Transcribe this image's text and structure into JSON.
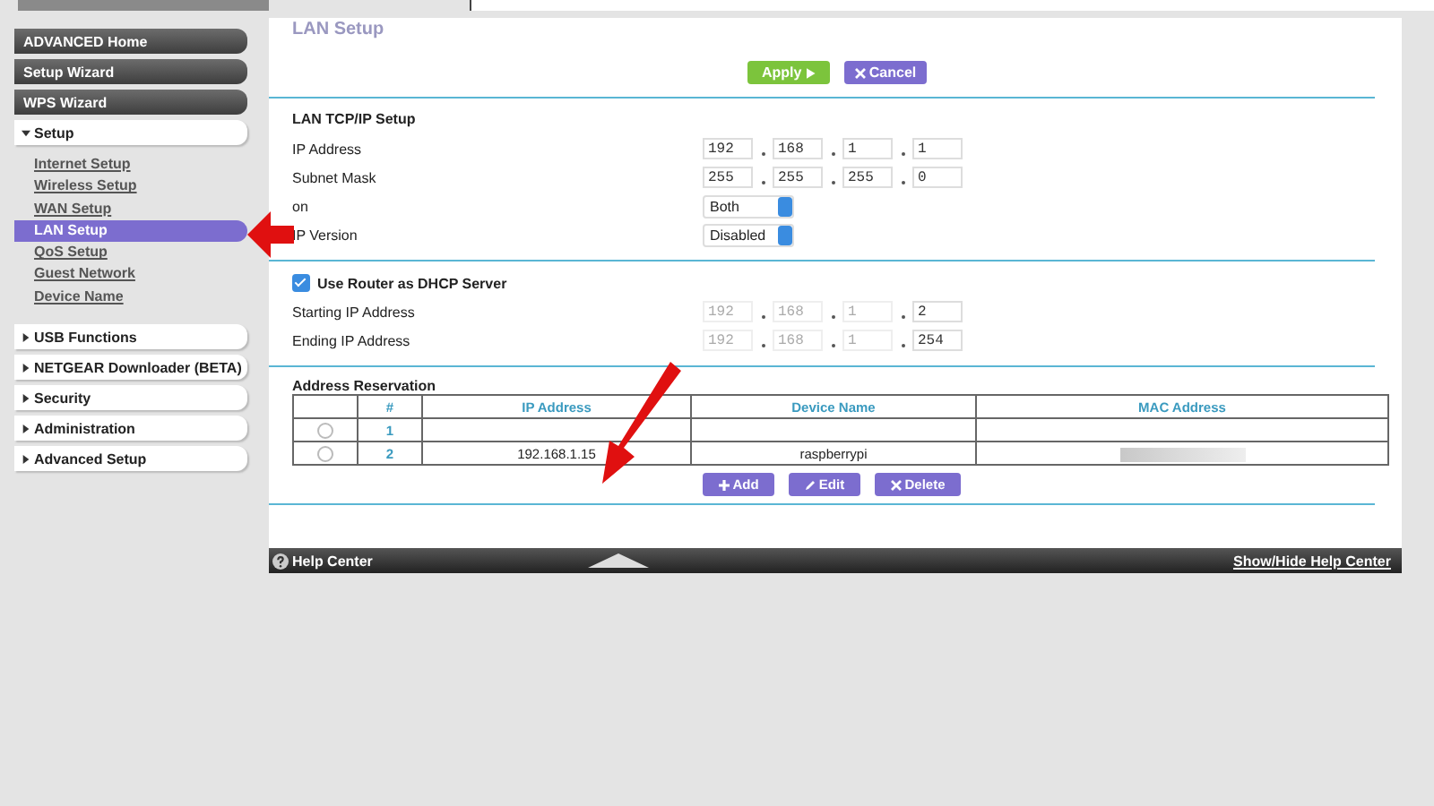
{
  "sidebar": {
    "buttons": [
      {
        "label": "ADVANCED Home"
      },
      {
        "label": "Setup Wizard"
      },
      {
        "label": "WPS Wizard"
      }
    ],
    "sections": [
      {
        "label": "Setup",
        "expanded": true,
        "children": [
          {
            "label": "Internet Setup",
            "selected": false
          },
          {
            "label": "Wireless Setup",
            "selected": false
          },
          {
            "label": "WAN Setup",
            "selected": false
          },
          {
            "label": "LAN Setup",
            "selected": true
          },
          {
            "label": "QoS Setup",
            "selected": false
          },
          {
            "label": "Guest Network",
            "selected": false
          },
          {
            "label": "Device Name",
            "selected": false
          }
        ]
      },
      {
        "label": "USB Functions",
        "expanded": false
      },
      {
        "label": "NETGEAR Downloader (BETA)",
        "expanded": false
      },
      {
        "label": "Security",
        "expanded": false
      },
      {
        "label": "Administration",
        "expanded": false
      },
      {
        "label": "Advanced Setup",
        "expanded": false
      }
    ]
  },
  "page": {
    "title": "LAN Setup",
    "actions": [
      {
        "label": "Apply",
        "kind": "apply"
      },
      {
        "label": "Cancel",
        "kind": "cancel"
      }
    ]
  },
  "tcpip": {
    "heading": "LAN TCP/IP Setup",
    "rows": [
      {
        "label": "IP Address",
        "kind": "ip",
        "octets": [
          {
            "value": "192",
            "disabled": false
          },
          {
            "value": "168",
            "disabled": false
          },
          {
            "value": "1",
            "disabled": false
          },
          {
            "value": "1",
            "disabled": false
          }
        ]
      },
      {
        "label": "Subnet Mask",
        "kind": "ip",
        "octets": [
          {
            "value": "255",
            "disabled": false
          },
          {
            "value": "255",
            "disabled": false
          },
          {
            "value": "255",
            "disabled": false
          },
          {
            "value": "0",
            "disabled": false
          }
        ]
      },
      {
        "label": "on",
        "kind": "select",
        "value": "Both"
      },
      {
        "label": "IP Version",
        "kind": "select",
        "value": "Disabled"
      }
    ]
  },
  "dhcp": {
    "label": "Use Router as DHCP Server",
    "checked": true,
    "rows": [
      {
        "label": "Starting IP Address",
        "kind": "ip",
        "octets": [
          {
            "value": "192",
            "disabled": true
          },
          {
            "value": "168",
            "disabled": true
          },
          {
            "value": "1",
            "disabled": true
          },
          {
            "value": "2",
            "disabled": false
          }
        ]
      },
      {
        "label": "Ending IP Address",
        "kind": "ip",
        "octets": [
          {
            "value": "192",
            "disabled": true
          },
          {
            "value": "168",
            "disabled": true
          },
          {
            "value": "1",
            "disabled": true
          },
          {
            "value": "254",
            "disabled": false
          }
        ]
      }
    ]
  },
  "reservation": {
    "heading": "Address Reservation",
    "columns": [
      "#",
      "IP Address",
      "Device Name",
      "MAC Address"
    ],
    "rows": [
      {
        "selected": false,
        "number": "1",
        "ip": "",
        "device": "",
        "mac_redacted": false
      },
      {
        "selected": false,
        "number": "2",
        "ip": "192.168.1.15",
        "device": "raspberrypi",
        "mac_redacted": true
      }
    ],
    "buttons": [
      {
        "label": "Add",
        "kind": "add"
      },
      {
        "label": "Edit",
        "kind": "edit"
      },
      {
        "label": "Delete",
        "kind": "delete"
      }
    ]
  },
  "footer": {
    "help": "Help Center",
    "toggle": "Show/Hide Help Center"
  }
}
